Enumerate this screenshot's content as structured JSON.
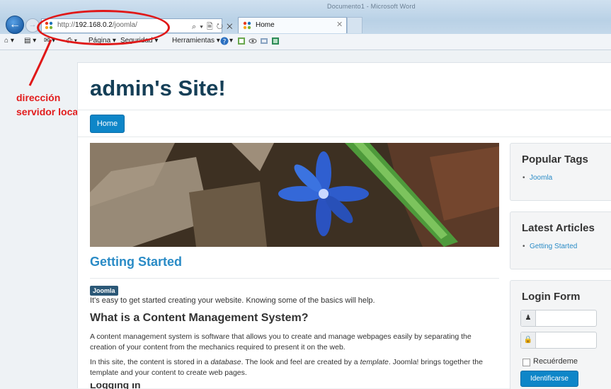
{
  "browser": {
    "window_title": "Documento1 - Microsoft Word",
    "address_prefix": "http://",
    "address_host": "192.168.0.2",
    "address_path": "/joomla/",
    "address_tools": "⌕ ▾ 🖹 ↻ ✕",
    "tab_title": "Home",
    "tab_close": "✕",
    "menus": {
      "pagina": "Página ▾",
      "seguridad": "Seguridad ▾",
      "herramientas": "Herramientas ▾"
    }
  },
  "annotation": {
    "line1": "dirección",
    "line2": "servidor local",
    "color": "#e01818"
  },
  "site": {
    "title": "admin's Site!",
    "nav_home": "Home"
  },
  "article": {
    "title": "Getting Started",
    "tag": "Joomla",
    "intro": "It's easy to get started creating your website. Knowing some of the basics will help.",
    "heading": "What is a Content Management System?",
    "para1": "A content management system is software that allows you to create and manage webpages easily by separating the creation of your content from the mechanics required to present it on the web.",
    "para2_a": "In this site, the content is stored in a ",
    "para2_em1": "database",
    "para2_b": ". The look and feel are created by a ",
    "para2_em2": "template",
    "para2_c": ". Joomla! brings together the template and your content to create web pages.",
    "next_heading": "Logging In"
  },
  "sidebar": {
    "popular_tags": {
      "title": "Popular Tags",
      "items": [
        "Joomla"
      ]
    },
    "latest_articles": {
      "title": "Latest Articles",
      "items": [
        "Getting Started"
      ]
    },
    "login": {
      "title": "Login Form",
      "user_icon": "user-icon",
      "lock_icon": "lock-icon",
      "remember": "Recuérdeme",
      "submit": "Identificarse"
    }
  },
  "colors": {
    "brand_blue": "#0e86c8",
    "title_navy": "#153f57",
    "link_blue": "#2a8bc6"
  }
}
